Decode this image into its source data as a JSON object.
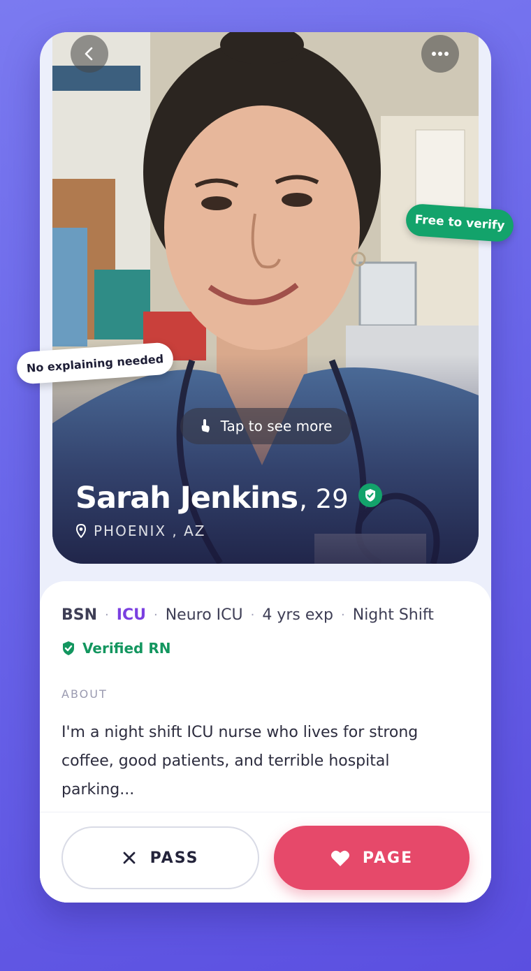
{
  "profile": {
    "name": "Sarah Jenkins",
    "age_text": ", 29",
    "location": "PHOENIX , AZ",
    "verified": true
  },
  "photo": {
    "tap_hint": "Tap to see more",
    "back_icon": "chevron-left-icon",
    "more_icon": "more-horizontal-icon"
  },
  "stickers": {
    "free_to_verify": "Free to verify",
    "no_explaining": "No explaining needed"
  },
  "tags": {
    "degree": "BSN",
    "unit": "ICU",
    "specialty": "Neuro ICU",
    "experience": "4 yrs exp",
    "shift": "Night Shift",
    "separator": "·"
  },
  "verification": {
    "label": "Verified RN"
  },
  "about": {
    "label": "ABOUT",
    "text": "I'm a night shift ICU nurse who lives for strong coffee, good patients, and terrible hospital parking..."
  },
  "actions": {
    "pass_label": "PASS",
    "page_label": "PAGE"
  },
  "colors": {
    "accent_green": "#13a36b",
    "accent_purple": "#7a3fe0",
    "page_button": "#e6496a",
    "background": "#6a66ea"
  }
}
